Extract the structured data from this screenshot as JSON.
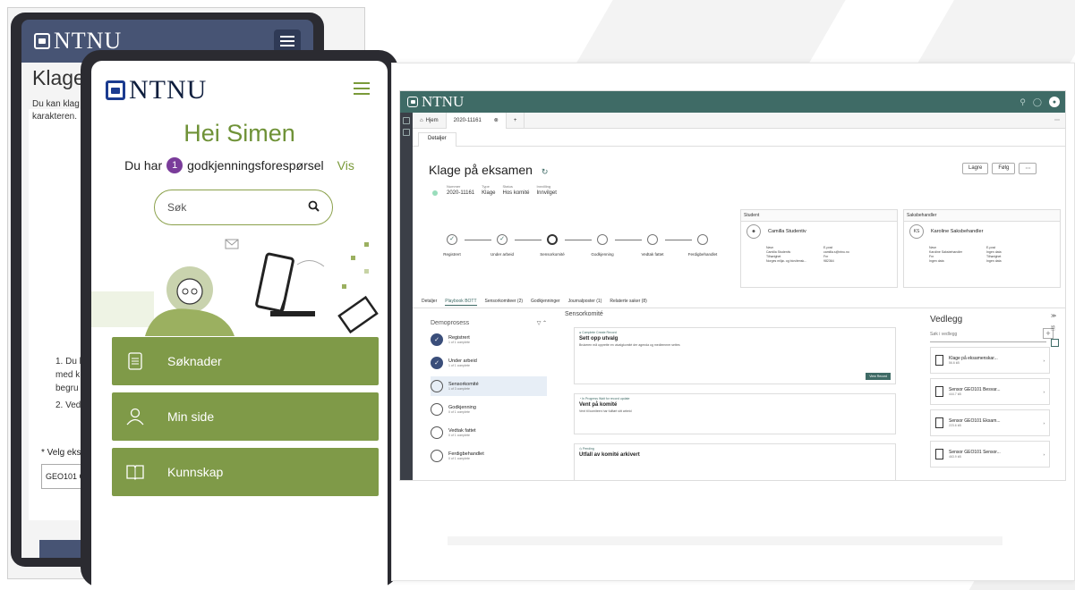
{
  "back_phone": {
    "logo": "NTNU",
    "page_title": "Klage",
    "description": "Du kan klag karakteren.",
    "list_items": [
      "1. Du k",
      "med k",
      "begru",
      "2. Ved"
    ],
    "select_label": "* Velg eksa",
    "select_value": "GEO101 Gu"
  },
  "front_phone": {
    "logo": "NTNU",
    "greeting": "Hei Simen",
    "notice_prefix": "Du har",
    "notice_count": "1",
    "notice_suffix": "godkjenningsforespørsel",
    "notice_link": "Vis",
    "search_placeholder": "Søk",
    "buttons": [
      {
        "label": "Søknader",
        "icon": "document-icon"
      },
      {
        "label": "Min side",
        "icon": "person-icon"
      },
      {
        "label": "Kunnskap",
        "icon": "book-icon"
      }
    ]
  },
  "desktop": {
    "logo": "NTNU",
    "tabs": [
      "Hjem",
      "2020-11161"
    ],
    "subtab": "Detaljer",
    "case_title": "Klage på eksamen",
    "actions": [
      "Lagre",
      "Følg"
    ],
    "meta": {
      "nummer_label": "Nummer",
      "nummer": "2020-11161",
      "type_label": "Type",
      "type": "Klage",
      "status_label": "Status",
      "status": "Hos komité",
      "innvilling_label": "Innvilling",
      "innvilling": "Innvilget"
    },
    "steps": [
      "Registrert",
      "Under arbeid",
      "Sensorkomité",
      "Godkjenning",
      "Vedtak fattet",
      "Ferdigbehandlet"
    ],
    "student": {
      "header": "Student",
      "initials": "",
      "name": "Camilla Studentiv",
      "left": "Navn\nCamilla Studentiv\nTilhørighet\nNorges miljø- og biovitensk...",
      "right": "E-post\ncamilla.s@ntnu.no\nFnr\n982364"
    },
    "saksbehandler": {
      "header": "Saksbehandler",
      "initials": "KS",
      "name": "Karoline Saksbehandler",
      "left": "Navn\nKaroline Saksbehandler\nFnr\nIngen data",
      "right": "E-post\nIngen data\nTilhørighet\nIngen data"
    },
    "section_tabs": [
      "Detaljer",
      "Playbook BOTT",
      "Sensorkomiteer (2)",
      "Godkjenninger",
      "Journalposter (1)",
      "Relaterte saker (8)"
    ],
    "process_title": "Demoprosess",
    "process": [
      {
        "name": "Registrert",
        "sub": "1 of 1 complete"
      },
      {
        "name": "Under arbeid",
        "sub": "1 of 1 complete"
      },
      {
        "name": "Sensorkomité",
        "sub": "1 of 3 complete"
      },
      {
        "name": "Godkjenning",
        "sub": "0 of 1 complete"
      },
      {
        "name": "Vedtak fattet",
        "sub": "0 of 1 complete"
      },
      {
        "name": "Ferdigbehandlet",
        "sub": "0 of 1 complete"
      }
    ],
    "main_title": "Sensorkomité",
    "cards": [
      {
        "status": "● Complete   Create Record",
        "title": "Sett opp utvalg",
        "desc": "Brukeren må opprette en utvalgkomité der agenda og medlemmer settes",
        "button": "View Record"
      },
      {
        "status": "◔ In Progress   Wait for record update",
        "title": "Vent på komité",
        "desc": "Vent til komiteen har fullført sitt arbeid",
        "button": ""
      },
      {
        "status": "◷ Pending",
        "title": "Utfall av komité arkivert",
        "desc": "",
        "button": ""
      }
    ],
    "attachments_title": "Vedlegg",
    "attachments_search": "Søk i vedlegg",
    "attachments": [
      {
        "name": "Klage på eksamenskar...",
        "size": "56.6 kB"
      },
      {
        "name": "Sensor GEO101 Besvar...",
        "size": "444.7 kB"
      },
      {
        "name": "Sensor GEO101 Eksam...",
        "size": "223.6 kB"
      },
      {
        "name": "Sensor GEO101 Sensor...",
        "size": "463.9 kB"
      }
    ]
  }
}
